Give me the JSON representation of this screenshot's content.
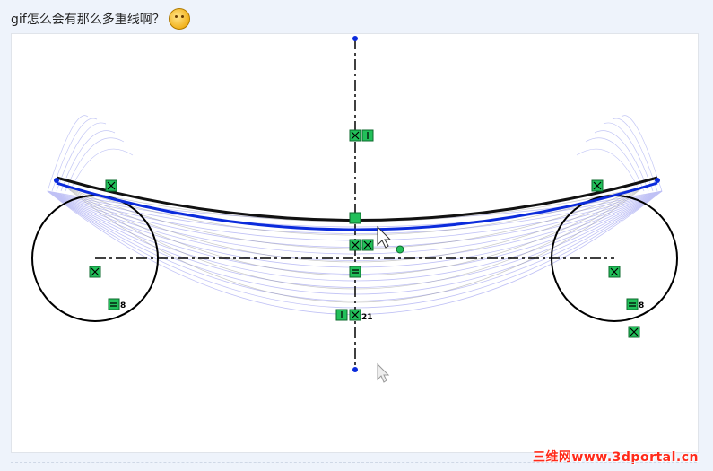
{
  "post": {
    "title": "gif怎么会有那么多重线啊？",
    "emoji_icon": "thinking-face-icon"
  },
  "sketch": {
    "annotations": {
      "left_equal": "8",
      "right_equal": "8",
      "center_label": "21"
    },
    "colors": {
      "active_curve": "#0b2bdc",
      "profile": "#000000",
      "ghost_curves": "#6b6ff0",
      "relation_box": "#22c05a"
    }
  },
  "watermark": {
    "text": "三维网www.3dportal.cn"
  }
}
